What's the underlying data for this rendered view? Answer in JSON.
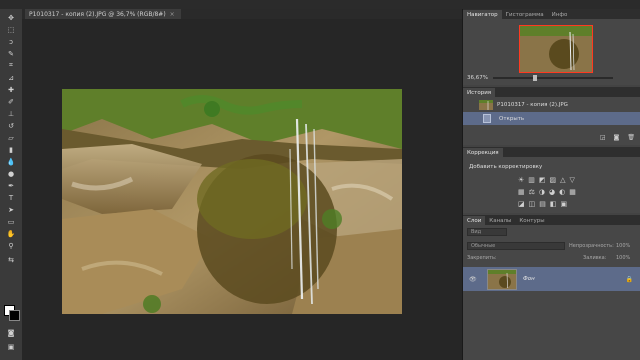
{
  "document": {
    "tab_title": "P1010317 - копия (2).JPG @ 36,7% (RGB/8#)",
    "close_glyph": "×"
  },
  "navigator": {
    "tabs": [
      "Навигатор",
      "Гистограмма",
      "Инфо"
    ],
    "zoom": "36,67%",
    "zoom_level_fraction": 0.35
  },
  "history": {
    "tab": "История",
    "items": [
      {
        "label": "P1010317 - копия (2).JPG",
        "icon": "image-thumbnail"
      },
      {
        "label": "Открыть",
        "icon": "open-document-icon"
      }
    ]
  },
  "corrections": {
    "tab": "Коррекция",
    "title": "Добавить корректировку",
    "row1": [
      "☀",
      "▥",
      "◩",
      "▨",
      "△",
      "▽"
    ],
    "row2": [
      "▦",
      "⚖",
      "◑",
      "◕",
      "◐",
      "▦"
    ],
    "row3": [
      "◪",
      "◫",
      "▤",
      "◧",
      "▣"
    ]
  },
  "layers": {
    "tabs": [
      "Слои",
      "Каналы",
      "Контуры"
    ],
    "filter": "Вид",
    "blend_mode": "Обычные",
    "opacity_label": "Непрозрачность:",
    "opacity_value": "100%",
    "lock_label": "Закрепить:",
    "fill_label": "Заливка:",
    "fill_value": "100%",
    "layer_name": "Фон"
  },
  "colors": {
    "panel_bg": "#474747",
    "selection": "#5d6b8a",
    "accent_red": "#ff3a20"
  }
}
